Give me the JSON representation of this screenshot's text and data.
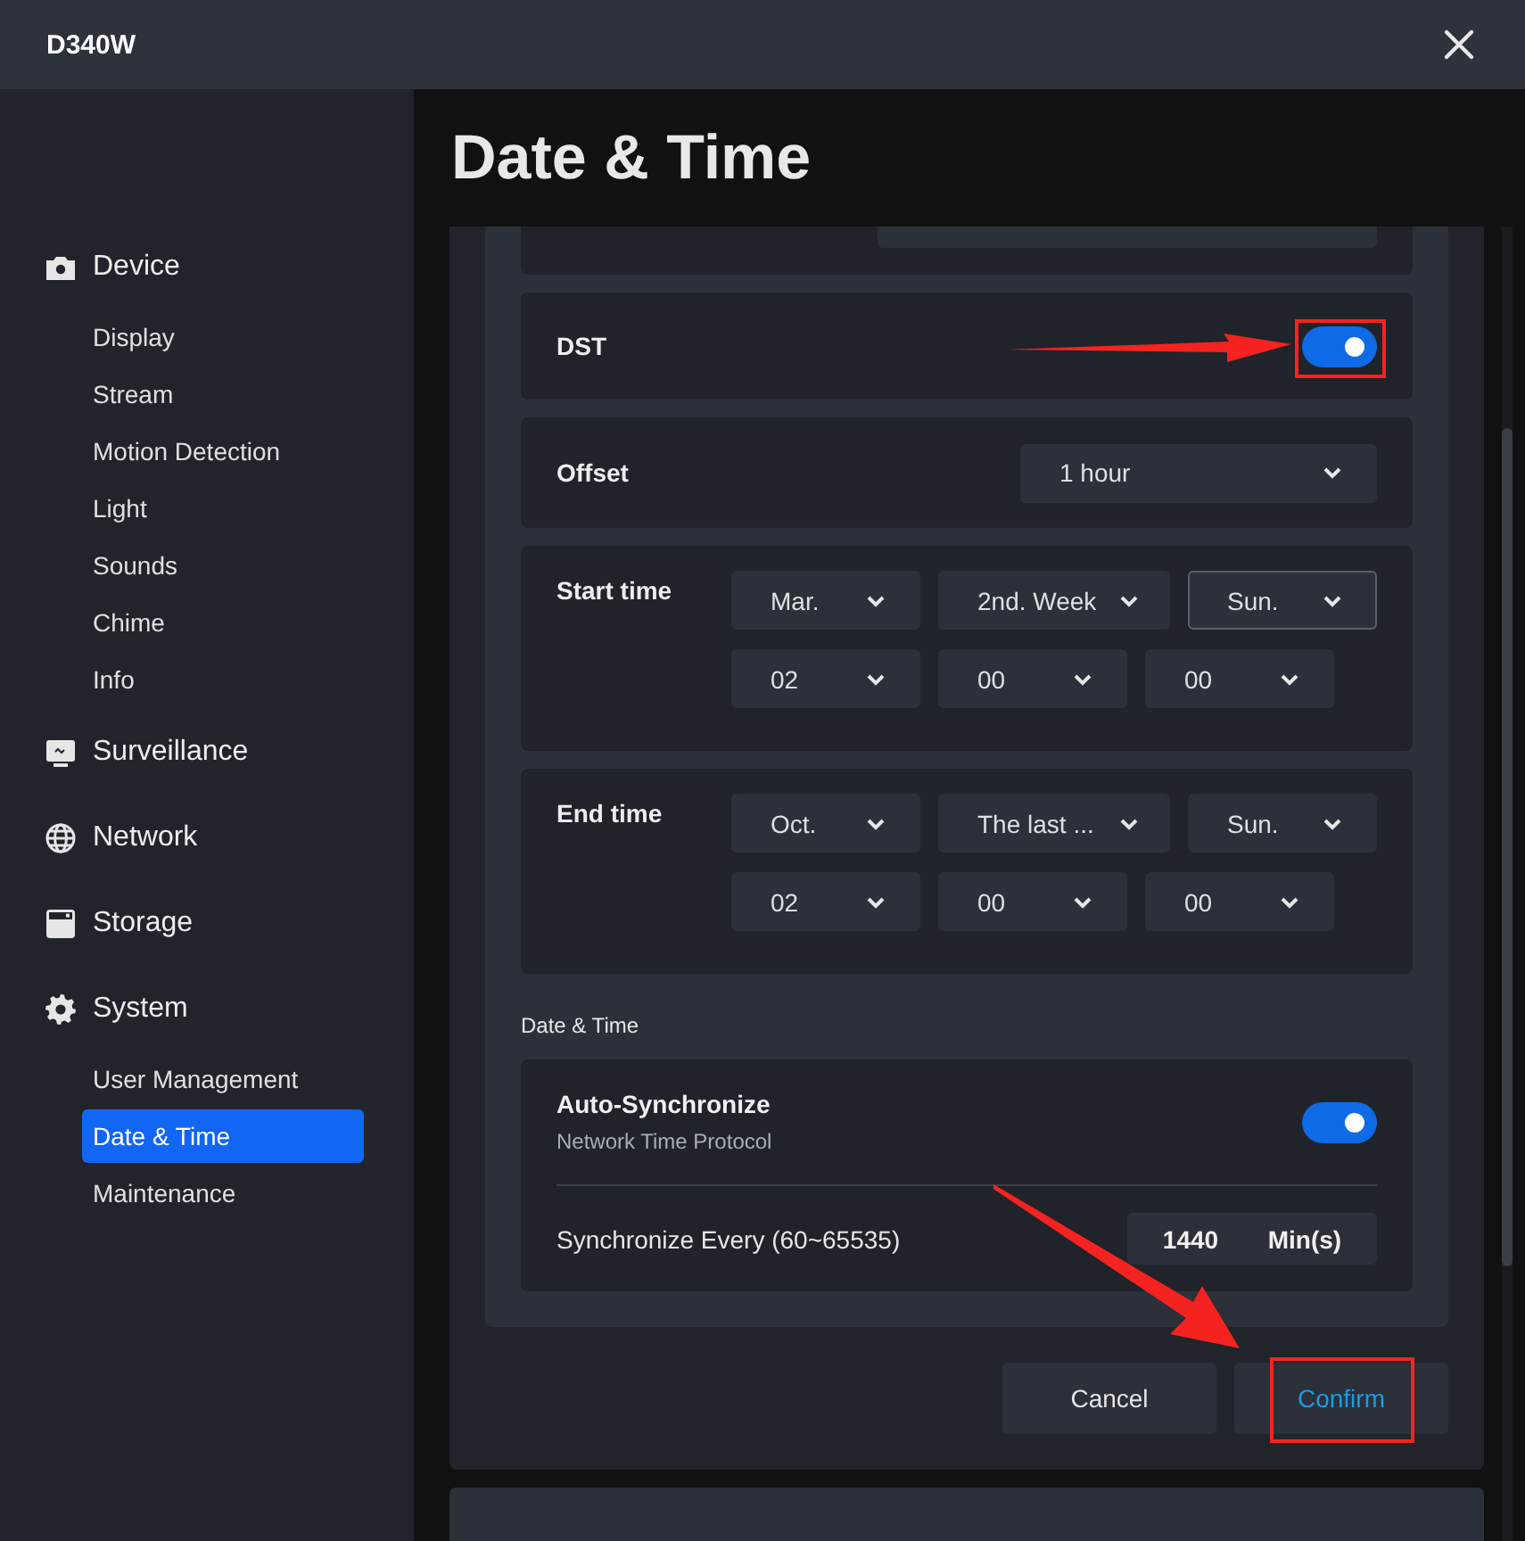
{
  "window": {
    "title": "D340W"
  },
  "sidebar": {
    "groups": [
      {
        "label": "Device",
        "children": [
          {
            "label": "Display",
            "selected": false
          },
          {
            "label": "Stream",
            "selected": false
          },
          {
            "label": "Motion Detection",
            "selected": false
          },
          {
            "label": "Light",
            "selected": false
          },
          {
            "label": "Sounds",
            "selected": false
          },
          {
            "label": "Chime",
            "selected": false
          },
          {
            "label": "Info",
            "selected": false
          }
        ]
      },
      {
        "label": "Surveillance"
      },
      {
        "label": "Network"
      },
      {
        "label": "Storage"
      },
      {
        "label": "System",
        "children": [
          {
            "label": "User Management",
            "selected": false
          },
          {
            "label": "Date & Time",
            "selected": true
          },
          {
            "label": "Maintenance",
            "selected": false
          }
        ]
      }
    ]
  },
  "page": {
    "title": "Date & Time"
  },
  "dst": {
    "label": "DST",
    "on": true,
    "highlighted": true
  },
  "offset": {
    "label": "Offset",
    "value": "1 hour"
  },
  "periods": [
    {
      "label": "Start time",
      "rows": [
        [
          {
            "value": "Mar.",
            "focused": false
          },
          {
            "value": "2nd. Week",
            "focused": false
          },
          {
            "value": "Sun.",
            "focused": true
          }
        ],
        [
          {
            "value": "02",
            "focused": false
          },
          {
            "value": "00",
            "focused": false
          },
          {
            "value": "00",
            "focused": false
          }
        ]
      ]
    },
    {
      "label": "End time",
      "rows": [
        [
          {
            "value": "Oct.",
            "focused": false
          },
          {
            "value": "The last ...",
            "focused": false
          },
          {
            "value": "Sun.",
            "focused": false
          }
        ],
        [
          {
            "value": "02",
            "focused": false
          },
          {
            "value": "00",
            "focused": false
          },
          {
            "value": "00",
            "focused": false
          }
        ]
      ]
    }
  ],
  "sync": {
    "heading": "Date & Time",
    "auto_sync": {
      "label": "Auto-Synchronize",
      "description": "Network Time Protocol",
      "on": true
    },
    "interval": {
      "label": "Synchronize Every (60~65535)",
      "value": "1440",
      "unit": "Min(s)"
    }
  },
  "buttons": [
    {
      "label": "Cancel",
      "kind": "secondary"
    },
    {
      "label": "Confirm",
      "kind": "primary",
      "highlighted": true
    }
  ]
}
